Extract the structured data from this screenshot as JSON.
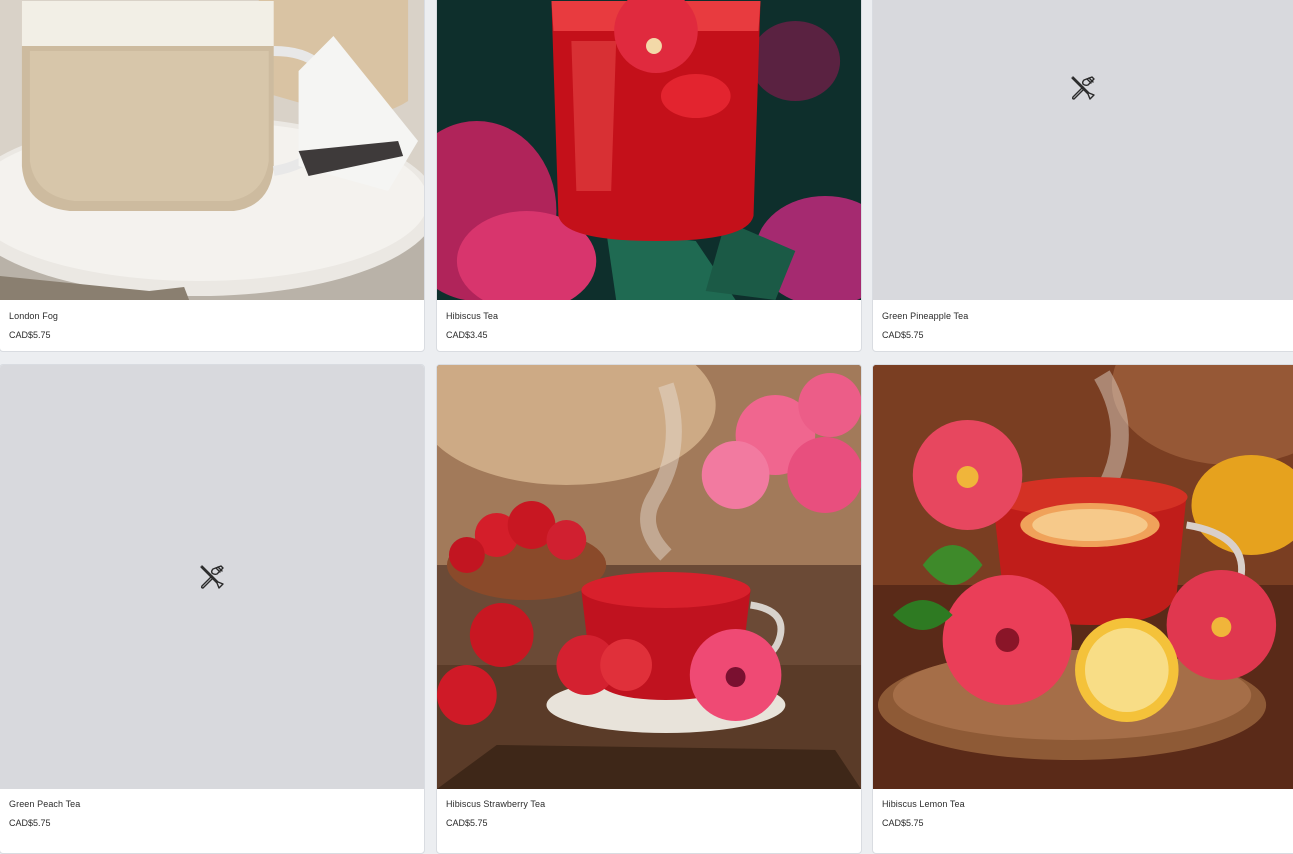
{
  "products": [
    {
      "name": "London Fog",
      "price": "CAD$5.75",
      "image": "london-fog-photo"
    },
    {
      "name": "Hibiscus Tea",
      "price": "CAD$3.45",
      "image": "hibiscus-tea-photo"
    },
    {
      "name": "Green Pineapple Tea",
      "price": "CAD$5.75",
      "image": "fork-knife-placeholder-icon"
    },
    {
      "name": "Green Peach Tea",
      "price": "CAD$5.75",
      "image": "fork-knife-placeholder-icon"
    },
    {
      "name": "Hibiscus Strawberry Tea",
      "price": "CAD$5.75",
      "image": "hibiscus-strawberry-tea-photo"
    },
    {
      "name": "Hibiscus Lemon Tea",
      "price": "CAD$5.75",
      "image": "hibiscus-lemon-tea-photo"
    }
  ],
  "colors": {
    "page_background": "#eceef1",
    "card_background": "#ffffff",
    "placeholder_background": "#d8d9dd",
    "text": "#2b2b2b"
  }
}
